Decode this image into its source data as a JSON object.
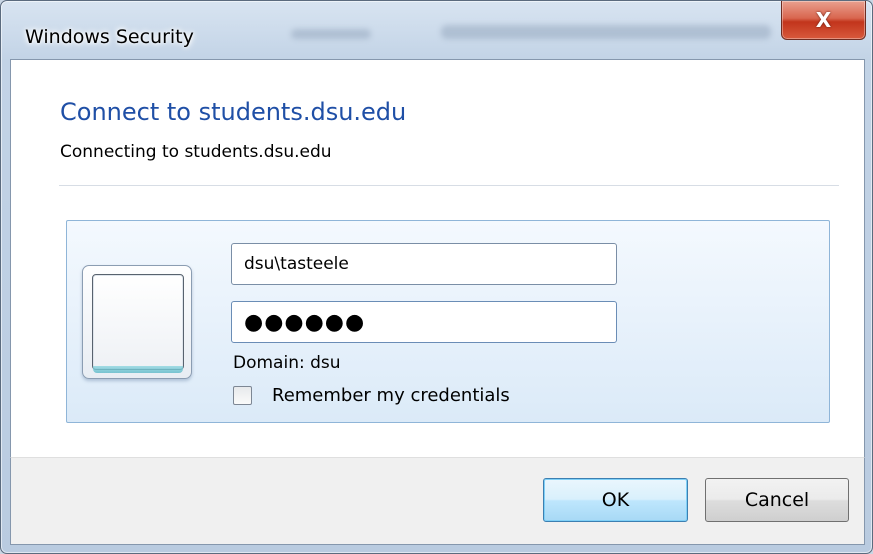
{
  "window": {
    "title": "Windows Security",
    "close_label": "X"
  },
  "dialog": {
    "heading": "Connect to students.dsu.edu",
    "subheading": "Connecting to students.dsu.edu"
  },
  "credentials": {
    "username_value": "dsu\\tasteele",
    "password_masked": "●●●●●●",
    "domain_label": "Domain: dsu",
    "remember_label": "Remember my credentials",
    "remember_checked": false
  },
  "buttons": {
    "ok_label": "OK",
    "cancel_label": "Cancel"
  },
  "colors": {
    "heading_blue": "#1f4fa6",
    "close_red": "#c2351c"
  }
}
